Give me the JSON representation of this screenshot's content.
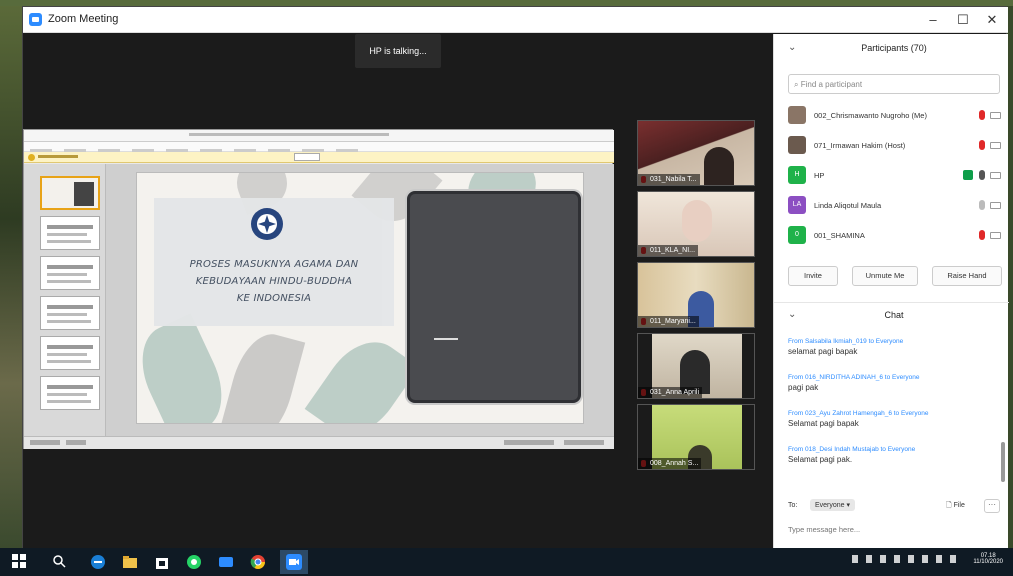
{
  "window": {
    "title": "Zoom Meeting",
    "controls": [
      "–",
      "☐",
      "✕"
    ]
  },
  "meeting": {
    "talking": "HP is talking..."
  },
  "slide": {
    "title_lines": [
      "PROSES MASUKNYA AGAMA DAN",
      "KEBUDAYAAN HINDU-BUDDHA",
      "KE INDONESIA"
    ]
  },
  "gallery": [
    {
      "name": "031_Nabila T...",
      "bg": "#7a3a3a"
    },
    {
      "name": "011_KLA_NI...",
      "bg": "#d9c7b8"
    },
    {
      "name": "011_Maryani...",
      "bg": "#c9b78f"
    },
    {
      "name": "031_Anna Aprili",
      "bg": "#cfc4b2"
    },
    {
      "name": "008_Annah S...",
      "bg": "#b9d16b"
    }
  ],
  "participants": {
    "title": "Participants (70)",
    "search_placeholder": "Find a participant",
    "list": [
      {
        "initials": "",
        "name": "002_Chrismawanto Nugroho (Me)",
        "color": "#8a7566",
        "mic": "muted"
      },
      {
        "initials": "",
        "name": "071_Irmawan Hakim (Host)",
        "color": "#6b5a4e",
        "mic": "muted"
      },
      {
        "initials": "H",
        "name": "HP",
        "color": "#1fb24a",
        "mic": "on"
      },
      {
        "initials": "LA",
        "name": "Linda Aliqotul Maula",
        "color": "#8c4fc2",
        "mic": "off"
      },
      {
        "initials": "0",
        "name": "001_SHAMINA",
        "color": "#1fb24a",
        "mic": "muted"
      }
    ],
    "buttons": [
      "Invite",
      "Unmute Me",
      "Raise Hand"
    ]
  },
  "chat": {
    "title": "Chat",
    "messages": [
      {
        "from": "From Salsabila Ikmiah_019 to Everyone",
        "text": "selamat pagi bapak"
      },
      {
        "from": "From 016_NIRDITHA ADINAH_6 to Everyone",
        "text": "pagi pak"
      },
      {
        "from": "From 023_Ayu Zahrot Hamengah_6 to Everyone",
        "text": "Selamat pagi bapak"
      },
      {
        "from": "From 018_Desi Indah Mustajab to Everyone",
        "text": "Selamat pagi pak."
      }
    ],
    "to_label": "To:",
    "recipient": "Everyone ▾",
    "file_label": "File",
    "more_label": "···",
    "input_placeholder": "Type message here..."
  },
  "taskbar": {
    "time": "07.18",
    "date": "11/10/2020"
  }
}
